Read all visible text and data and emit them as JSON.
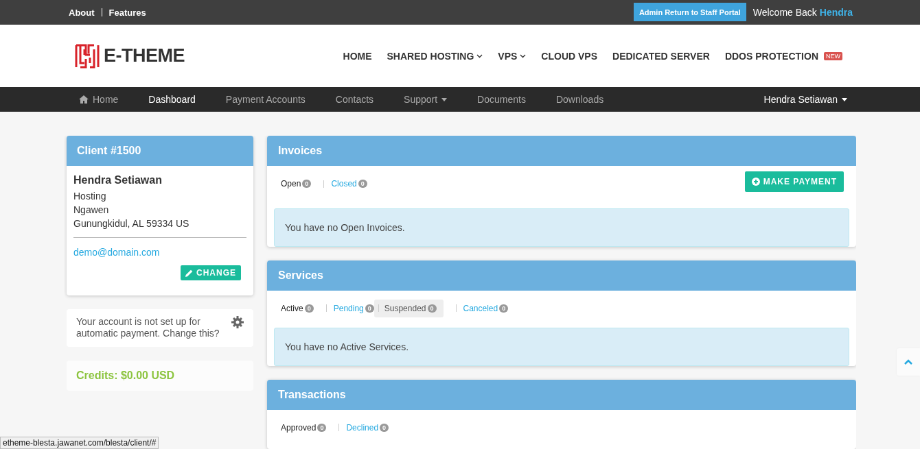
{
  "top_bar": {
    "links": [
      "About",
      "Features"
    ],
    "admin_button": "Admin Return to Staff Portal",
    "welcome": "Welcome Back",
    "user": "Hendra"
  },
  "header": {
    "logo": "E-THEME",
    "menu": [
      {
        "label": "HOME",
        "dropdown": false
      },
      {
        "label": "SHARED HOSTING",
        "dropdown": true
      },
      {
        "label": "VPS",
        "dropdown": true
      },
      {
        "label": "CLOUD VPS",
        "dropdown": false
      },
      {
        "label": "DEDICATED SERVER",
        "dropdown": false
      },
      {
        "label": "DDOS PROTECTION",
        "dropdown": false,
        "badge": "NEW"
      }
    ]
  },
  "nav": {
    "items": [
      {
        "label": "Home",
        "selected": false,
        "icon": true,
        "dropdown": false
      },
      {
        "label": "Dashboard",
        "selected": true,
        "icon": false,
        "dropdown": false
      },
      {
        "label": "Payment Accounts",
        "selected": false,
        "icon": false,
        "dropdown": false
      },
      {
        "label": "Contacts",
        "selected": false,
        "icon": false,
        "dropdown": false
      },
      {
        "label": "Support",
        "selected": false,
        "icon": false,
        "dropdown": true
      },
      {
        "label": "Documents",
        "selected": false,
        "icon": false,
        "dropdown": false
      },
      {
        "label": "Downloads",
        "selected": false,
        "icon": false,
        "dropdown": false
      }
    ],
    "user": "Hendra Setiawan"
  },
  "sidebar": {
    "client": {
      "title": "Client #1500",
      "name": "Hendra Setiawan",
      "address": [
        "Hosting",
        "Ngawen",
        "Gunungkidul, AL 59334 US"
      ],
      "email": "demo@domain.com",
      "button": "CHANGE"
    },
    "autopay_notice": "Your account is not set up for automatic payment. Change this?",
    "credits": "Credits: $0.00 USD"
  },
  "panels": [
    {
      "title": "Invoices",
      "tabs": [
        {
          "label": "Open",
          "count": "0",
          "selected": true,
          "hovered": false
        },
        {
          "label": "Closed",
          "count": "0",
          "selected": false,
          "hovered": false
        }
      ],
      "action": "MAKE PAYMENT",
      "message": "You have no Open Invoices."
    },
    {
      "title": "Services",
      "tabs": [
        {
          "label": "Active",
          "count": "0",
          "selected": true,
          "hovered": false
        },
        {
          "label": "Pending",
          "count": "0",
          "selected": false,
          "hovered": false
        },
        {
          "label": "Suspended",
          "count": "0",
          "selected": false,
          "hovered": true
        },
        {
          "label": "Canceled",
          "count": "0",
          "selected": false,
          "hovered": false
        }
      ],
      "message": "You have no Active Services."
    },
    {
      "title": "Transactions",
      "tabs": [
        {
          "label": "Approved",
          "count": "0",
          "selected": true,
          "hovered": false
        },
        {
          "label": "Declined",
          "count": "0",
          "selected": false,
          "hovered": false
        }
      ]
    }
  ],
  "status_url": "etheme-blesta.jawanet.com/blesta/client/#"
}
